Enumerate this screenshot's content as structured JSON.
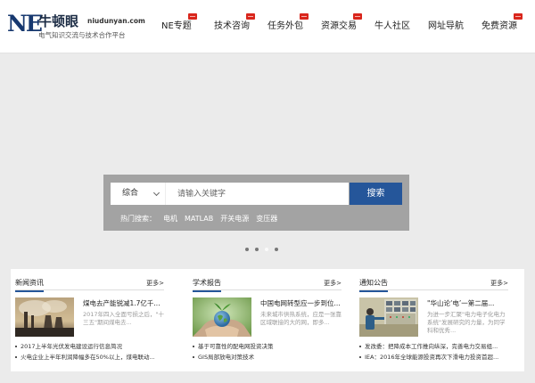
{
  "brand": {
    "logo_mark": "NE",
    "name": "牛顿眼",
    "domain": "niudunyan.com",
    "slogan": "电气知识交流与技术合作平台"
  },
  "nav": {
    "items": [
      {
        "label": "NE专题",
        "hot": true
      },
      {
        "label": "技术咨询",
        "hot": true
      },
      {
        "label": "任务外包",
        "hot": true
      },
      {
        "label": "资源交易",
        "hot": true
      },
      {
        "label": "牛人社区",
        "hot": false
      },
      {
        "label": "网址导航",
        "hot": false
      },
      {
        "label": "免费资源",
        "hot": true
      }
    ],
    "badge_color": "#d9261c"
  },
  "search": {
    "category": "综合",
    "placeholder": "请输入关键字",
    "button_label": "搜索",
    "hot_label": "热门搜索：",
    "hot_terms": [
      "电机",
      "MATLAB",
      "开关电源",
      "变压器"
    ]
  },
  "carousel": {
    "slide_count": 4,
    "active_index": 2
  },
  "sections": [
    {
      "title": "新闻资讯",
      "more": "更多>",
      "image": "power-plant-photo",
      "headline": "煤电去产能锐减1.7亿千...",
      "summary": "2017年四入全面亏损之后，\"十三五\"期间煤电去...",
      "list": [
        "2017上半年光伏发电建设运行信息简况",
        "火电企业上半年利润降幅多在50%以上，煤电联动..."
      ]
    },
    {
      "title": "学术报告",
      "more": "更多>",
      "image": "plant-globe-photo",
      "headline": "中国电网转型应一步到位...",
      "summary": "未来城市供热系统，应是一张靠区域联接的大的网，即多...",
      "list": [
        "基于可靠性的配电网投资决策",
        "GIS局部放电对策技术"
      ]
    },
    {
      "title": "通知公告",
      "more": "更多>",
      "image": "control-room-photo",
      "headline": "\"华山论‘电’一第二届...",
      "summary": "为进一步汇聚\"电力电子化电力系统\"发展研究的力量，为同学科和优秀...",
      "list": [
        "发改委：把降成本工作推向纵深，完善电力交易组...",
        "IEA：2016年全球能源投资再次下滑电力投资首超..."
      ]
    }
  ],
  "colors": {
    "accent": "#25569a",
    "brand_dark": "#17386f",
    "page_bg": "#ebebeb"
  }
}
